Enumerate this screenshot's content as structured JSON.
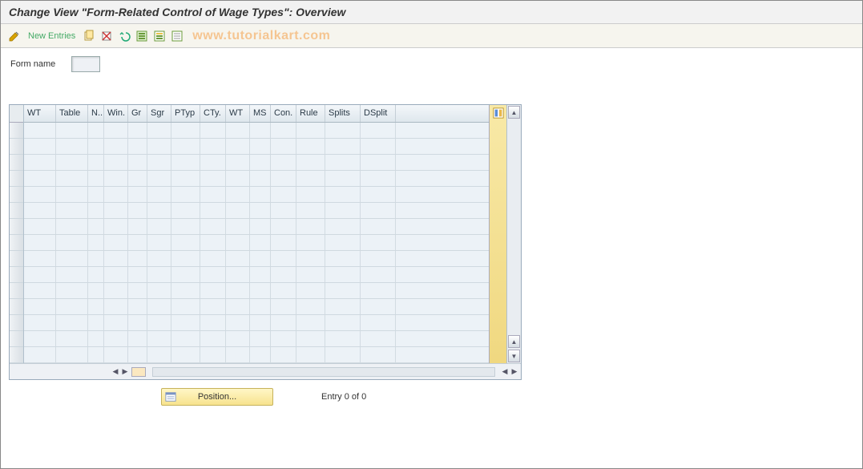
{
  "title": "Change View \"Form-Related Control of Wage Types\": Overview",
  "toolbar": {
    "new_entries": "New Entries"
  },
  "watermark": "www.tutorialkart.com",
  "form": {
    "name_label": "Form name",
    "name_value": ""
  },
  "table": {
    "columns": [
      "WT",
      "Table",
      "N..",
      "Win.",
      "Gr",
      "Sgr",
      "PTyp",
      "CTy.",
      "WT",
      "MS",
      "Con.",
      "Rule",
      "Splits",
      "DSplit"
    ],
    "row_count": 15
  },
  "footer": {
    "position_label": "Position...",
    "entry_text": "Entry 0 of 0"
  }
}
